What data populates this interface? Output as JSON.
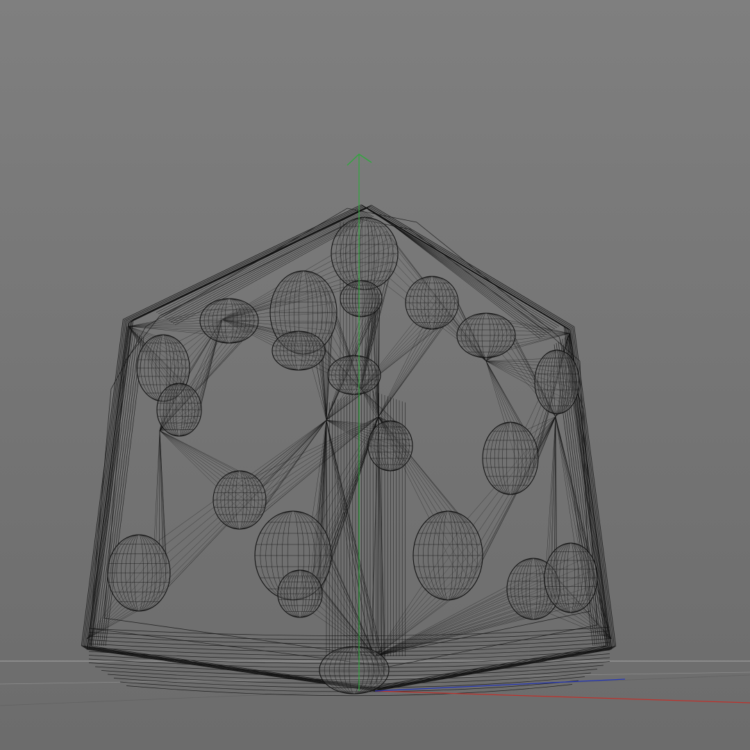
{
  "viewport": {
    "view_mode": "wireframe",
    "background_top": "#7f7f7f",
    "background_bottom": "#6c6c6c",
    "wire_color": "#111111",
    "grid_line_color": "#b5b5b5"
  },
  "axes": {
    "y_axis_color": "#2fa83c",
    "x_axis_color": "#c0302a",
    "z_axis_color": "#2436b8"
  },
  "model": {
    "description_icon": "wireframe-dice-mesh",
    "pip_count": 21
  }
}
